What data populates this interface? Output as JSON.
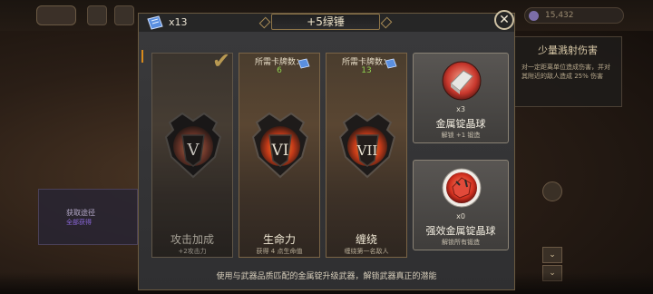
{
  "background": {
    "resource_text": "15,432",
    "right_panel": {
      "title": "少量溅射伤害",
      "text": "对一定距离单位造成伤害，并对其附近的敌人造成 25% 伤害"
    },
    "left_box": {
      "title": "获取途径",
      "subtitle": "全部获得"
    },
    "down_arrow": "⌄"
  },
  "header": {
    "ticket_count": "x13",
    "title": "+5绿锤",
    "close_label": "✕"
  },
  "cards": [
    {
      "numeral": "V",
      "name": "攻击加成",
      "desc": "+2攻击力",
      "completed": true,
      "check": "✔"
    },
    {
      "numeral": "VI",
      "req_label": "所需卡牌数：",
      "req_value": "6",
      "name": "生命力",
      "desc": "获得 4 点生命值",
      "completed": false
    },
    {
      "numeral": "VII",
      "req_label": "所需卡牌数：",
      "req_value": "13",
      "name": "缠绕",
      "desc": "缠绕第一名敌人",
      "completed": false
    }
  ],
  "ingots": [
    {
      "count": "x3",
      "name": "金属锭晶球",
      "desc": "解锁 +1 锻造",
      "icon": "silver-ingot-orb-icon",
      "orb_color": "#c8372c",
      "metal_color": "#e8e6e2"
    },
    {
      "count": "x0",
      "name": "强效金属锭晶球",
      "desc": "解锁所有锻造",
      "icon": "red-ingot-orb-icon",
      "orb_color": "#d2301f",
      "metal_color": "#e24a3a"
    }
  ],
  "footer": {
    "text": "使用与武器品质匹配的金属锭升级武器，解锁武器真正的潜能"
  },
  "colors": {
    "accent_gold": "#f5b21a",
    "req_green": "#8fd14f",
    "ticket_blue": "#5a8fe0"
  }
}
